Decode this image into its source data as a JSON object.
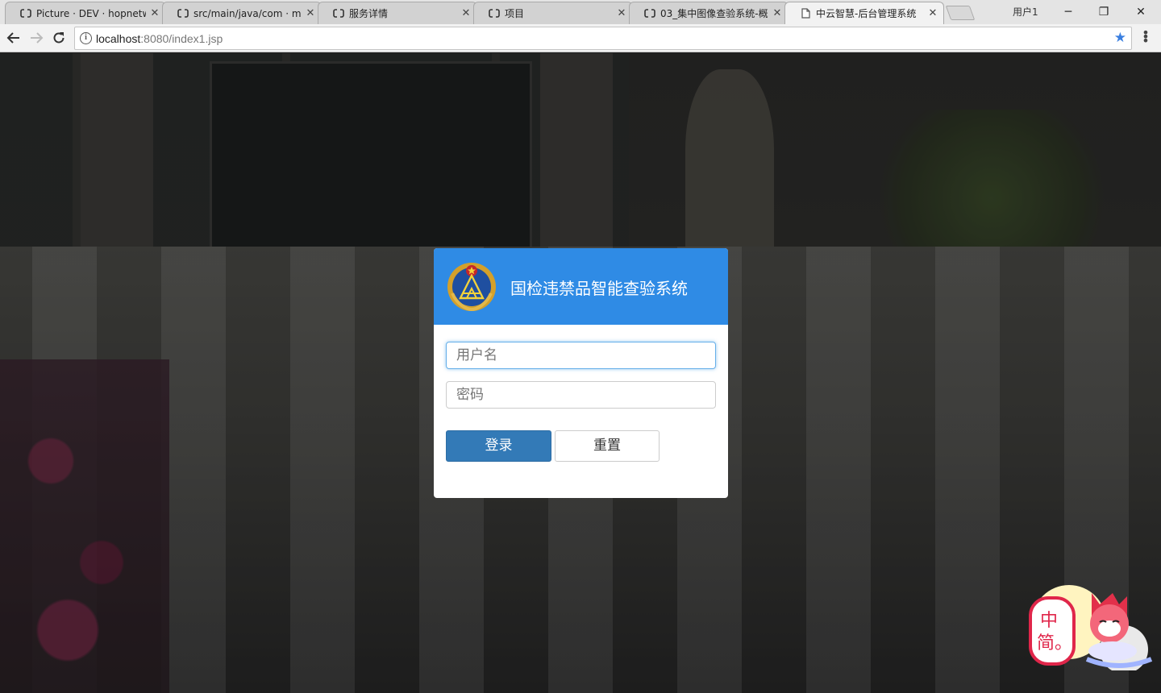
{
  "browser": {
    "tabs": [
      {
        "title": "Picture · DEV · hopnetw",
        "icon": "code-icon",
        "active": false
      },
      {
        "title": "src/main/java/com · ma",
        "icon": "code-icon",
        "active": false
      },
      {
        "title": "服务详情",
        "icon": "code-icon",
        "active": false
      },
      {
        "title": "项目",
        "icon": "code-icon",
        "active": false
      },
      {
        "title": "03_集中图像查验系统-概",
        "icon": "code-icon",
        "active": false
      },
      {
        "title": "中云智慧-后台管理系统",
        "icon": "page-icon",
        "active": true
      }
    ],
    "profile_label": "用户1",
    "url_host": "localhost",
    "url_rest": ":8080/index1.jsp"
  },
  "login": {
    "title": "国检违禁品智能查验系统",
    "username_placeholder": "用户名",
    "password_placeholder": "密码",
    "login_label": "登录",
    "reset_label": "重置"
  },
  "ime": {
    "line1": "中",
    "line2": "简。"
  },
  "colors": {
    "header_blue": "#2f8be5",
    "login_button": "#337ab7",
    "bookmark_star": "#3a7fe0"
  }
}
